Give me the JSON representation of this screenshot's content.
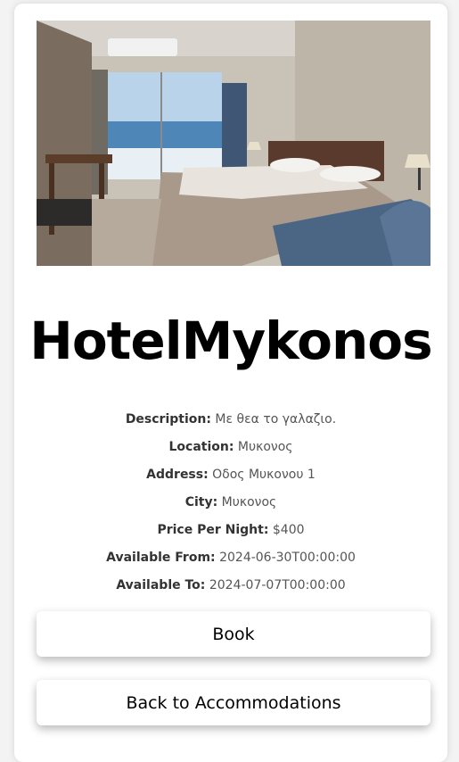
{
  "hotel": {
    "image_alt": "Hotel room with sea view",
    "name": "HotelMykonos",
    "details": [
      {
        "label": "Description:",
        "value": "Με θεα το γαλαζιο."
      },
      {
        "label": "Location:",
        "value": "Μυκονος"
      },
      {
        "label": "Address:",
        "value": "Οδος Μυκονου 1"
      },
      {
        "label": "City:",
        "value": "Μυκονος"
      },
      {
        "label": "Price Per Night:",
        "value": "$400"
      },
      {
        "label": "Available From:",
        "value": "2024-06-30T00:00:00"
      },
      {
        "label": "Available To:",
        "value": "2024-07-07T00:00:00"
      }
    ]
  },
  "actions": {
    "book_label": "Book",
    "back_label": "Back to Accommodations"
  }
}
